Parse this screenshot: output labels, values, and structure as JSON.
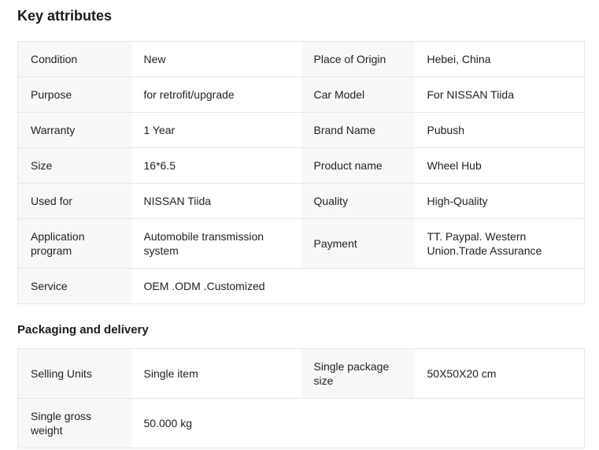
{
  "colors": {
    "label_cell_bg": "#f8f8f8",
    "table_border": "#e6e6e6",
    "text": "#222222",
    "heading": "#1a1a1a",
    "page_bg": "#ffffff"
  },
  "sections": [
    {
      "title": "Key attributes",
      "rows": [
        {
          "cells": [
            {
              "label": "Condition",
              "value": "New"
            },
            {
              "label": "Place of Origin",
              "value": "Hebei, China"
            }
          ]
        },
        {
          "cells": [
            {
              "label": "Purpose",
              "value": "for retrofit/upgrade"
            },
            {
              "label": "Car Model",
              "value": "For NISSAN Tiida"
            }
          ]
        },
        {
          "cells": [
            {
              "label": "Warranty",
              "value": "1 Year"
            },
            {
              "label": "Brand Name",
              "value": "Pubush"
            }
          ]
        },
        {
          "cells": [
            {
              "label": "Size",
              "value": "16*6.5"
            },
            {
              "label": "Product name",
              "value": "Wheel Hub"
            }
          ]
        },
        {
          "cells": [
            {
              "label": "Used for",
              "value": "NISSAN Tiida"
            },
            {
              "label": "Quality",
              "value": "High-Quality"
            }
          ]
        },
        {
          "cells": [
            {
              "label": "Application program",
              "value": "Automobile transmission system"
            },
            {
              "label": "Payment",
              "value": "TT. Paypal. Western Union.Trade Assurance"
            }
          ]
        },
        {
          "cells": [
            {
              "label": "Service",
              "value": "OEM .ODM .Customized"
            }
          ]
        }
      ]
    },
    {
      "title": "Packaging and delivery",
      "rows": [
        {
          "cells": [
            {
              "label": "Selling Units",
              "value": "Single item"
            },
            {
              "label": "Single package size",
              "value": "50X50X20 cm"
            }
          ]
        },
        {
          "cells": [
            {
              "label": "Single gross weight",
              "value": "50.000 kg"
            }
          ]
        }
      ]
    }
  ]
}
